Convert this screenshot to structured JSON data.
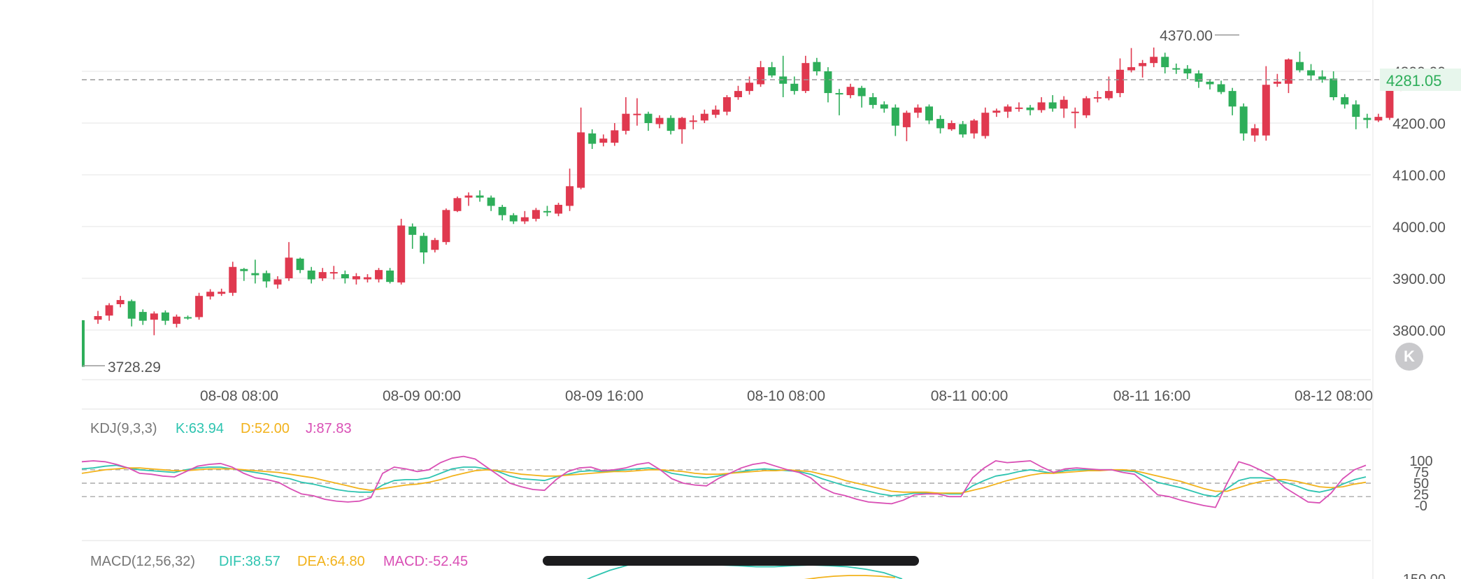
{
  "colors": {
    "up": "#e0394f",
    "down": "#2eae5a",
    "k_line": "#2ec4b0",
    "d_line": "#f2b21b",
    "j_line": "#d94fb5",
    "text": "#555555",
    "grid": "#eeeeee",
    "ref_line": "#aaaaaa",
    "last_price_bg": "#e7f6ec",
    "last_price_text": "#2eae5a"
  },
  "chart_data": [
    {
      "type": "candlestick",
      "title": "",
      "y_ticks": [
        "4300.00",
        "4200.00",
        "4100.00",
        "4000.00",
        "3900.00",
        "3800.00"
      ],
      "x_ticks": [
        "08-08 08:00",
        "08-09 00:00",
        "08-09 16:00",
        "08-10 08:00",
        "08-11 00:00",
        "08-11 16:00",
        "08-12 08:00"
      ],
      "high_label": "4370.00",
      "low_label": "3728.29",
      "last_price": "4281.05",
      "candles": [
        [
          3819,
          3729,
          3819,
          3729
        ],
        [
          3820,
          3827,
          3837,
          3812
        ],
        [
          3828,
          3848,
          3852,
          3818
        ],
        [
          3850,
          3858,
          3866,
          3844
        ],
        [
          3856,
          3822,
          3859,
          3807
        ],
        [
          3835,
          3818,
          3840,
          3810
        ],
        [
          3820,
          3832,
          3836,
          3790
        ],
        [
          3834,
          3818,
          3838,
          3810
        ],
        [
          3812,
          3826,
          3830,
          3805
        ],
        [
          3825,
          3824,
          3828,
          3820
        ],
        [
          3825,
          3866,
          3872,
          3820
        ],
        [
          3865,
          3874,
          3879,
          3859
        ],
        [
          3870,
          3874,
          3880,
          3866
        ],
        [
          3872,
          3922,
          3932,
          3866
        ],
        [
          3918,
          3914,
          3920,
          3895
        ],
        [
          3910,
          3906,
          3936,
          3890
        ],
        [
          3910,
          3894,
          3915,
          3882
        ],
        [
          3888,
          3898,
          3904,
          3880
        ],
        [
          3900,
          3940,
          3970,
          3895
        ],
        [
          3938,
          3916,
          3940,
          3910
        ],
        [
          3915,
          3898,
          3922,
          3890
        ],
        [
          3900,
          3912,
          3920,
          3895
        ],
        [
          3910,
          3912,
          3924,
          3898
        ],
        [
          3908,
          3900,
          3915,
          3890
        ],
        [
          3898,
          3904,
          3910,
          3888
        ],
        [
          3898,
          3902,
          3908,
          3892
        ],
        [
          3898,
          3916,
          3920,
          3892
        ],
        [
          3915,
          3893,
          3920,
          3890
        ],
        [
          3892,
          4002,
          4015,
          3888
        ],
        [
          4000,
          3984,
          4006,
          3957
        ],
        [
          3982,
          3950,
          3988,
          3928
        ],
        [
          3955,
          3974,
          3978,
          3950
        ],
        [
          3970,
          4032,
          4035,
          3965
        ],
        [
          4030,
          4055,
          4058,
          4028
        ],
        [
          4056,
          4060,
          4066,
          4040
        ],
        [
          4060,
          4056,
          4070,
          4048
        ],
        [
          4056,
          4040,
          4060,
          4030
        ],
        [
          4038,
          4022,
          4042,
          4012
        ],
        [
          4022,
          4010,
          4026,
          4005
        ],
        [
          4010,
          4018,
          4030,
          4005
        ],
        [
          4015,
          4032,
          4036,
          4010
        ],
        [
          4030,
          4028,
          4040,
          4020
        ],
        [
          4025,
          4042,
          4046,
          4020
        ],
        [
          4040,
          4078,
          4112,
          4030
        ],
        [
          4075,
          4182,
          4230,
          4072
        ],
        [
          4180,
          4160,
          4188,
          4150
        ],
        [
          4162,
          4170,
          4178,
          4155
        ],
        [
          4162,
          4186,
          4200,
          4156
        ],
        [
          4185,
          4218,
          4250,
          4178
        ],
        [
          4218,
          4218,
          4248,
          4195
        ],
        [
          4218,
          4200,
          4222,
          4185
        ],
        [
          4198,
          4210,
          4215,
          4190
        ],
        [
          4210,
          4185,
          4215,
          4178
        ],
        [
          4188,
          4210,
          4212,
          4160
        ],
        [
          4205,
          4205,
          4215,
          4188
        ],
        [
          4205,
          4218,
          4226,
          4200
        ],
        [
          4216,
          4226,
          4234,
          4210
        ],
        [
          4222,
          4250,
          4254,
          4215
        ],
        [
          4250,
          4262,
          4272,
          4245
        ],
        [
          4262,
          4278,
          4290,
          4255
        ],
        [
          4275,
          4308,
          4320,
          4270
        ],
        [
          4308,
          4292,
          4318,
          4288
        ],
        [
          4290,
          4276,
          4330,
          4250
        ],
        [
          4276,
          4262,
          4290,
          4255
        ],
        [
          4262,
          4316,
          4330,
          4258
        ],
        [
          4318,
          4300,
          4326,
          4292
        ],
        [
          4300,
          4258,
          4308,
          4240
        ],
        [
          4258,
          4256,
          4266,
          4215
        ],
        [
          4254,
          4270,
          4276,
          4248
        ],
        [
          4268,
          4252,
          4272,
          4230
        ],
        [
          4250,
          4235,
          4258,
          4228
        ],
        [
          4236,
          4228,
          4242,
          4220
        ],
        [
          4230,
          4195,
          4236,
          4175
        ],
        [
          4192,
          4220,
          4224,
          4165
        ],
        [
          4220,
          4230,
          4236,
          4210
        ],
        [
          4232,
          4205,
          4236,
          4198
        ],
        [
          4208,
          4190,
          4215,
          4180
        ],
        [
          4188,
          4200,
          4205,
          4185
        ],
        [
          4198,
          4178,
          4204,
          4172
        ],
        [
          4180,
          4205,
          4208,
          4170
        ],
        [
          4175,
          4220,
          4230,
          4170
        ],
        [
          4220,
          4224,
          4228,
          4212
        ],
        [
          4222,
          4232,
          4236,
          4210
        ],
        [
          4230,
          4230,
          4240,
          4222
        ],
        [
          4230,
          4225,
          4235,
          4215
        ],
        [
          4225,
          4240,
          4250,
          4220
        ],
        [
          4240,
          4228,
          4254,
          4222
        ],
        [
          4228,
          4245,
          4252,
          4210
        ],
        [
          4220,
          4222,
          4230,
          4190
        ],
        [
          4215,
          4248,
          4252,
          4210
        ],
        [
          4250,
          4250,
          4262,
          4240
        ],
        [
          4248,
          4262,
          4290,
          4244
        ],
        [
          4258,
          4303,
          4325,
          4250
        ],
        [
          4302,
          4308,
          4345,
          4298
        ],
        [
          4310,
          4316,
          4322,
          4288
        ],
        [
          4316,
          4328,
          4346,
          4308
        ],
        [
          4328,
          4308,
          4336,
          4296
        ],
        [
          4306,
          4305,
          4315,
          4295
        ],
        [
          4305,
          4296,
          4312,
          4285
        ],
        [
          4296,
          4280,
          4302,
          4268
        ],
        [
          4280,
          4275,
          4285,
          4265
        ],
        [
          4275,
          4260,
          4282,
          4256
        ],
        [
          4262,
          4232,
          4268,
          4215
        ],
        [
          4232,
          4180,
          4238,
          4166
        ],
        [
          4176,
          4190,
          4198,
          4164
        ],
        [
          4176,
          4274,
          4310,
          4166
        ],
        [
          4276,
          4280,
          4295,
          4270
        ],
        [
          4276,
          4323,
          4325,
          4258
        ],
        [
          4318,
          4302,
          4338,
          4298
        ],
        [
          4302,
          4292,
          4314,
          4282
        ],
        [
          4290,
          4284,
          4302,
          4278
        ],
        [
          4286,
          4250,
          4300,
          4244
        ],
        [
          4250,
          4236,
          4256,
          4228
        ],
        [
          4236,
          4212,
          4244,
          4188
        ],
        [
          4210,
          4206,
          4218,
          4190
        ],
        [
          4205,
          4212,
          4218,
          4202
        ],
        [
          4210,
          4266,
          4270,
          4206
        ],
        [
          4266,
          4273,
          4280,
          4262
        ],
        [
          4268,
          4291,
          4304,
          4264
        ],
        [
          4284,
          4280,
          4292,
          4275
        ]
      ]
    },
    {
      "type": "line",
      "title": "KDJ(9,3,3)",
      "legend": [
        {
          "label": "K:63.94",
          "color": "#2ec4b0"
        },
        {
          "label": "D:52.00",
          "color": "#f2b21b"
        },
        {
          "label": "J:87.83",
          "color": "#d94fb5"
        }
      ],
      "y_ticks": [
        "100",
        "75",
        "50",
        "25",
        "-0"
      ],
      "ref_lines": [
        80,
        50,
        20
      ],
      "series": [
        {
          "values": [
            82,
            84,
            88,
            90,
            84,
            80,
            78,
            76,
            74,
            80,
            84,
            86,
            86,
            82,
            78,
            74,
            70,
            64,
            60,
            52,
            48,
            42,
            36,
            32,
            30,
            30,
            46,
            56,
            58,
            58,
            62,
            72,
            82,
            86,
            86,
            82,
            76,
            66,
            60,
            58,
            56,
            64,
            70,
            76,
            78,
            76,
            78,
            80,
            82,
            84,
            80,
            72,
            68,
            64,
            62,
            66,
            72,
            76,
            80,
            82,
            80,
            78,
            76,
            70,
            60,
            52,
            44,
            38,
            32,
            26,
            22,
            24,
            28,
            28,
            28,
            26,
            26,
            44,
            56,
            66,
            70,
            76,
            80,
            76,
            72,
            78,
            80,
            80,
            80,
            80,
            78,
            76,
            64,
            52,
            46,
            40,
            32,
            24,
            20,
            38,
            56,
            62,
            62,
            60,
            52,
            44,
            34,
            30,
            36,
            48,
            58,
            64
          ]
        },
        {
          "values": [
            72,
            76,
            80,
            82,
            84,
            84,
            82,
            80,
            78,
            78,
            80,
            82,
            82,
            82,
            80,
            78,
            76,
            74,
            70,
            66,
            62,
            56,
            50,
            44,
            38,
            34,
            38,
            42,
            46,
            48,
            52,
            58,
            66,
            72,
            78,
            80,
            78,
            74,
            70,
            68,
            66,
            66,
            68,
            70,
            72,
            74,
            76,
            76,
            78,
            80,
            80,
            78,
            76,
            72,
            70,
            70,
            72,
            74,
            76,
            78,
            78,
            80,
            78,
            76,
            70,
            64,
            56,
            50,
            44,
            38,
            32,
            30,
            30,
            30,
            28,
            28,
            28,
            34,
            40,
            48,
            56,
            62,
            68,
            72,
            72,
            74,
            76,
            78,
            78,
            80,
            80,
            78,
            72,
            66,
            60,
            54,
            46,
            38,
            32,
            32,
            40,
            48,
            54,
            58,
            58,
            54,
            48,
            42,
            40,
            42,
            48,
            52
          ]
        },
        {
          "values": [
            98,
            100,
            98,
            92,
            84,
            72,
            70,
            66,
            64,
            76,
            88,
            92,
            94,
            86,
            72,
            62,
            58,
            52,
            38,
            26,
            22,
            14,
            10,
            8,
            10,
            18,
            72,
            86,
            82,
            76,
            80,
            96,
            106,
            110,
            104,
            86,
            68,
            50,
            42,
            36,
            34,
            58,
            76,
            84,
            86,
            78,
            80,
            84,
            92,
            96,
            80,
            60,
            50,
            46,
            44,
            60,
            72,
            84,
            92,
            96,
            88,
            80,
            74,
            62,
            40,
            28,
            22,
            14,
            8,
            6,
            4,
            12,
            24,
            26,
            26,
            20,
            20,
            62,
            84,
            100,
            96,
            98,
            100,
            86,
            74,
            82,
            84,
            82,
            80,
            80,
            74,
            70,
            48,
            24,
            20,
            12,
            6,
            0,
            -4,
            50,
            98,
            90,
            78,
            64,
            40,
            24,
            8,
            6,
            28,
            60,
            80,
            90
          ]
        }
      ]
    },
    {
      "type": "line",
      "title": "MACD(12,56,32)",
      "legend": [
        {
          "label": "DIF:38.57",
          "color": "#2ec4b0"
        },
        {
          "label": "DEA:64.80",
          "color": "#f2b21b"
        },
        {
          "label": "MACD:-52.45",
          "color": "#d94fb5"
        }
      ],
      "y_ticks": [
        "150.00"
      ],
      "series": [
        {
          "values": [
            80,
            105,
            125,
            140,
            146,
            148,
            148,
            145,
            140,
            138,
            135,
            135,
            138,
            140,
            138,
            135,
            128,
            118,
            100
          ]
        },
        {
          "values": [
            60,
            66,
            72,
            80,
            90,
            98,
            104,
            108,
            110,
            110,
            108,
            104
          ]
        }
      ]
    }
  ]
}
